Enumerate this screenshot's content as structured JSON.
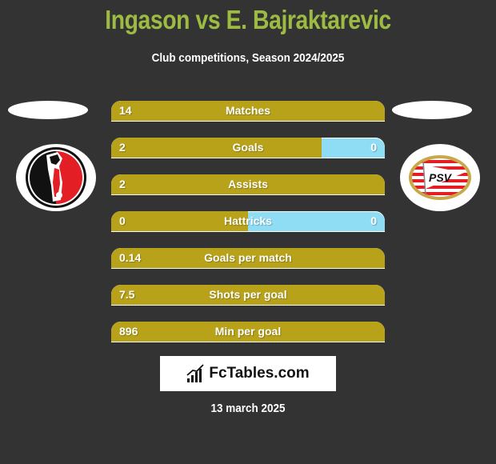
{
  "header": {
    "title": "Ingason vs E. Bajraktarevic",
    "subtitle": "Club competitions, Season 2024/2025"
  },
  "teams": {
    "left": {
      "logo": "helmond-sport-crest-icon"
    },
    "right": {
      "logo": "psv-crest-icon",
      "logo_text": "PSV"
    }
  },
  "colors": {
    "background": "#333333",
    "title": "#9dbb43",
    "left_bar": "#b8a21a",
    "right_bar": "#8fdcf5"
  },
  "stats": [
    {
      "label": "Matches",
      "left": "14",
      "right": "",
      "left_share": 1.0
    },
    {
      "label": "Goals",
      "left": "2",
      "right": "0",
      "left_share": 0.77
    },
    {
      "label": "Assists",
      "left": "2",
      "right": "",
      "left_share": 1.0
    },
    {
      "label": "Hattricks",
      "left": "0",
      "right": "0",
      "left_share": 0.5
    },
    {
      "label": "Goals per match",
      "left": "0.14",
      "right": "",
      "left_share": 1.0
    },
    {
      "label": "Shots per goal",
      "left": "7.5",
      "right": "",
      "left_share": 1.0
    },
    {
      "label": "Min per goal",
      "left": "896",
      "right": "",
      "left_share": 1.0
    }
  ],
  "brand": {
    "name": "FcTables.com",
    "icon": "bar-chart-icon"
  },
  "footer": {
    "date": "13 march 2025"
  }
}
